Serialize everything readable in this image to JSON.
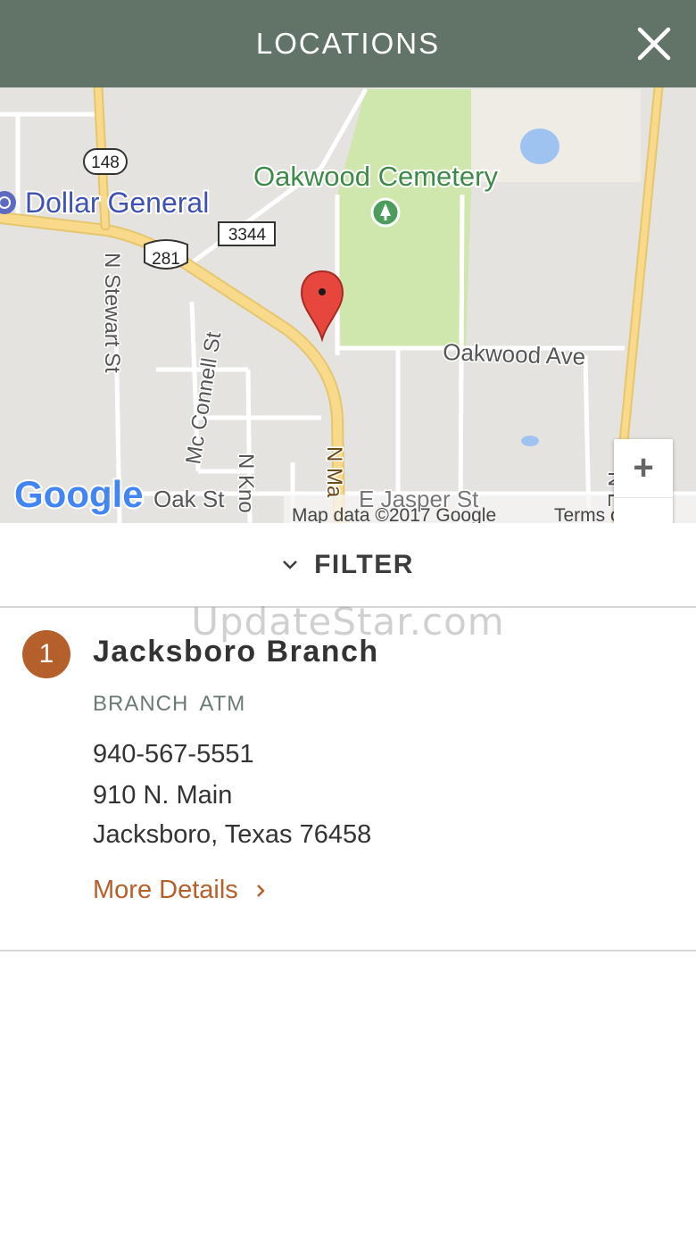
{
  "header": {
    "title": "LOCATIONS",
    "close_icon": "close-icon"
  },
  "map": {
    "labels": {
      "poi_dollar_general": "Dollar General",
      "poi_cemetery": "Oakwood Cemetery",
      "route_148": "148",
      "route_3344": "3344",
      "route_281": "281",
      "street_n_stewart": "N Stewart St",
      "street_mc_connell": "Mc Connell St",
      "street_n_kno": "N Kno",
      "street_n_main": "N Ma",
      "street_oakwood_ave": "Oakwood Ave",
      "street_oak": "Oak St",
      "street_e_jasper": "E Jasper St",
      "street_right": "N E",
      "google_logo": "Google",
      "map_data": "Map data ©2017 Google",
      "terms": "Terms of Use"
    },
    "zoom_in": "+",
    "zoom_out": "−",
    "colors": {
      "background": "#e5e3df",
      "park": "#cfe7ad",
      "major_road": "#f5d787",
      "water": "#9fc3f0",
      "pin": "#e6463c"
    }
  },
  "filter": {
    "label": "FILTER",
    "icon": "chevron-down-icon"
  },
  "watermark": "UpdateStar.com",
  "locations": [
    {
      "number": "1",
      "name": "Jacksboro Branch",
      "tags": [
        "BRANCH",
        "ATM"
      ],
      "phone": "940-567-5551",
      "street": "910 N. Main",
      "city": "Jacksboro, Texas 76458",
      "more_label": "More Details",
      "more_icon": "chevron-right-icon"
    }
  ],
  "colors": {
    "header_bg": "#627468",
    "accent": "#b5602b",
    "tag_text": "#6a7b72"
  }
}
